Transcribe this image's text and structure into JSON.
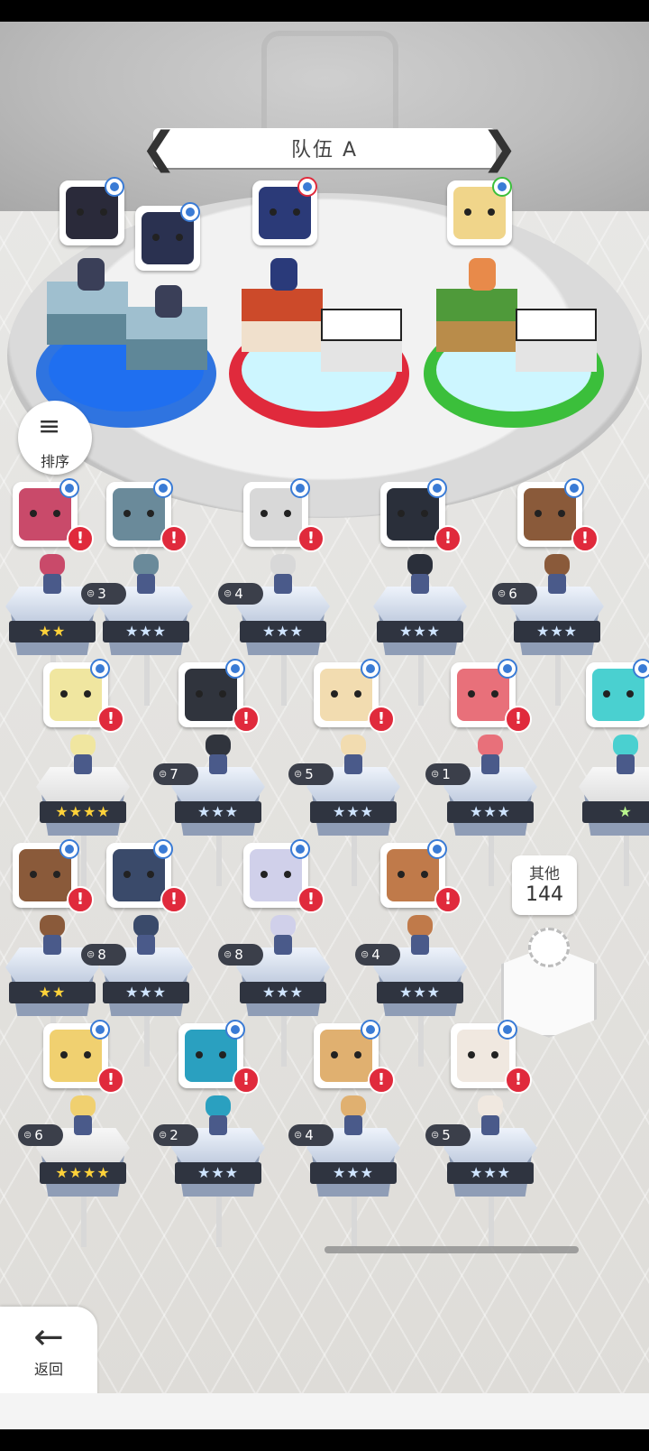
{
  "header": {
    "team_title": "队伍 A",
    "prev_arrow": "❮",
    "next_arrow": "❯"
  },
  "sort_button": {
    "icon": "≡",
    "label": "排序"
  },
  "other": {
    "label": "其他",
    "count": "144"
  },
  "back_button": {
    "icon": "←",
    "label": "返回"
  },
  "colors": {
    "water": "#2f74e0",
    "fire": "#e02a3c",
    "wood": "#3bbf3b",
    "alert": "#e02a3c",
    "plate": "#2f3440"
  },
  "team_slots": [
    {
      "element": "water",
      "units": 2
    },
    {
      "element": "fire",
      "units": 1
    },
    {
      "element": "wood",
      "units": 1
    }
  ],
  "roster": [
    {
      "row": 1,
      "cards": [
        {
          "stars": "★★",
          "level": ""
        },
        {
          "stars": "★★★",
          "level": "3"
        },
        {
          "stars": "★★★",
          "level": "4"
        },
        {
          "stars": "★★★",
          "level": ""
        },
        {
          "stars": "★★★",
          "level": "6"
        }
      ]
    },
    {
      "row": 2,
      "cards": [
        {
          "stars": "★★★★",
          "level": ""
        },
        {
          "stars": "★★★",
          "level": "7"
        },
        {
          "stars": "★★★",
          "level": "5"
        },
        {
          "stars": "★★★",
          "level": "1"
        },
        {
          "stars": "★",
          "level": ""
        }
      ]
    },
    {
      "row": 3,
      "cards": [
        {
          "stars": "★★",
          "level": ""
        },
        {
          "stars": "★★★",
          "level": "8"
        },
        {
          "stars": "★★★",
          "level": "8"
        },
        {
          "stars": "★★★",
          "level": "4"
        }
      ]
    },
    {
      "row": 4,
      "cards": [
        {
          "stars": "★★★★",
          "level": "6"
        },
        {
          "stars": "★★★",
          "level": "2"
        },
        {
          "stars": "★★★",
          "level": "4"
        },
        {
          "stars": "★★★",
          "level": "5"
        }
      ]
    }
  ],
  "alert_mark": "!",
  "level_icon": "⊜"
}
